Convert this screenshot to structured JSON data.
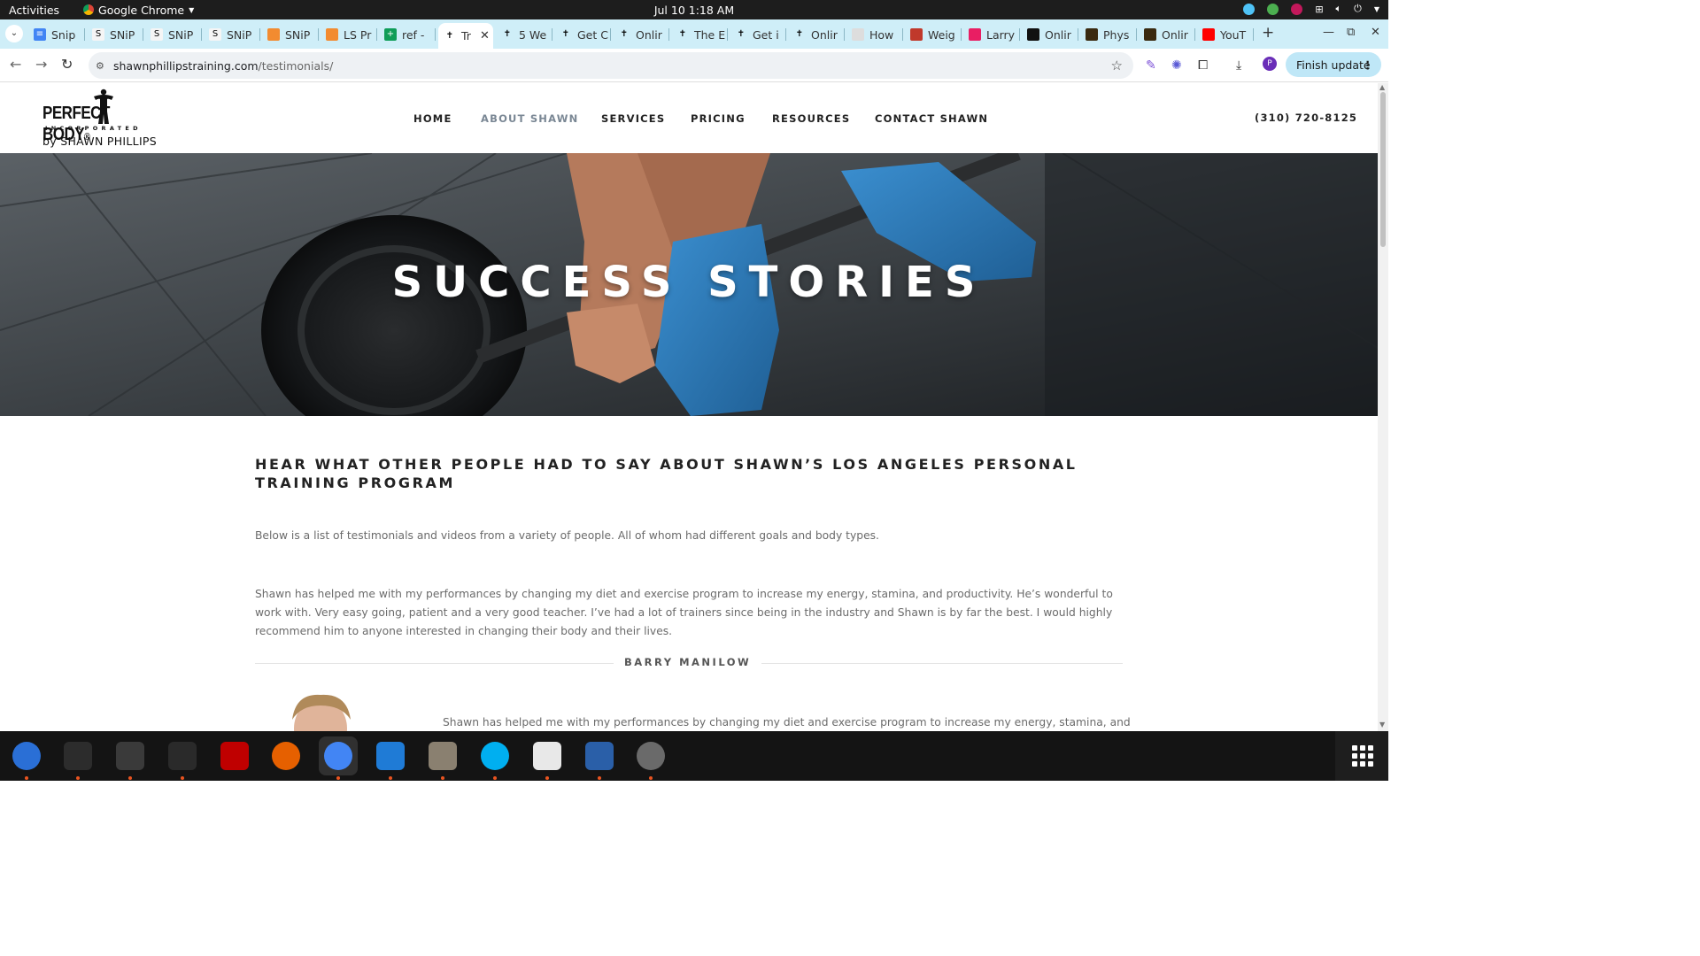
{
  "system_bar": {
    "activities": "Activities",
    "app_name": "Google Chrome",
    "clock": "Jul 10  1:18 AM"
  },
  "browser": {
    "tabs": [
      {
        "label": "Snip",
        "icon": "google-docs-icon"
      },
      {
        "label": "SNiP",
        "icon": "snip-icon"
      },
      {
        "label": "SNiP",
        "icon": "snip-icon"
      },
      {
        "label": "SNiP",
        "icon": "snip-icon"
      },
      {
        "label": "SNiP",
        "icon": "orange-chrome-icon"
      },
      {
        "label": "LS Pr",
        "icon": "orange-chrome-icon"
      },
      {
        "label": "ref - ",
        "icon": "google-sheets-icon"
      },
      {
        "label": "Tr",
        "icon": "perfect-body-icon",
        "active": true
      },
      {
        "label": "5 We",
        "icon": "perfect-body-icon"
      },
      {
        "label": "Get C",
        "icon": "perfect-body-icon"
      },
      {
        "label": "Onlir",
        "icon": "perfect-body-icon"
      },
      {
        "label": "The E",
        "icon": "perfect-body-icon"
      },
      {
        "label": "Get i",
        "icon": "perfect-body-icon"
      },
      {
        "label": "Onlir",
        "icon": "perfect-body-icon"
      },
      {
        "label": "How",
        "icon": "page-icon"
      },
      {
        "label": "Weig",
        "icon": "weight-icon"
      },
      {
        "label": "Larry",
        "icon": "larry-icon"
      },
      {
        "label": "Onlir",
        "icon": "black-square-icon"
      },
      {
        "label": "Phys",
        "icon": "phys-icon"
      },
      {
        "label": "Onlir",
        "icon": "phys-icon"
      },
      {
        "label": "YouT",
        "icon": "youtube-icon"
      }
    ],
    "url_host": "shawnphillipstraining.com",
    "url_path": "/testimonials/",
    "finish_update": "Finish update",
    "profile_initial": "P"
  },
  "site": {
    "logo": {
      "brand_left": "PERFECT",
      "brand_right": "BODY",
      "registered": "®",
      "incorporated": "INCORPORATED",
      "byline": "by SHAWN PHILLIPS"
    },
    "nav": {
      "home": "HOME",
      "about": "ABOUT SHAWN",
      "services": "SERVICES",
      "pricing": "PRICING",
      "resources": "RESOURCES",
      "contact": "CONTACT SHAWN"
    },
    "phone": "(310) 720-8125",
    "hero_title": "SUCCESS STORIES",
    "heading": "HEAR WHAT OTHER PEOPLE HAD TO SAY ABOUT SHAWN’S LOS ANGELES PERSONAL TRAINING PROGRAM",
    "intro": "Below is a list of testimonials and videos from a variety of people.  All of whom had different goals and body types.",
    "testimonial_1": {
      "text": "Shawn has helped me with my performances by changing my diet and exercise program to increase my energy, stamina, and productivity. He’s wonderful to work with. Very easy going, patient and a very good teacher. I’ve had a lot of trainers since being in the industry and Shawn is by far the best. I would highly recommend him to anyone interested in changing their body and their lives.",
      "author": "BARRY MANILOW"
    },
    "testimonial_2": {
      "text": "Shawn has helped me with my performances by changing my diet and exercise program to increase my energy, stamina, and"
    }
  },
  "dock": [
    {
      "name": "thunderbird",
      "color": "#2a6fd6"
    },
    {
      "name": "terminal",
      "color": "#2c2c2c"
    },
    {
      "name": "calculator",
      "color": "#3a3a3a"
    },
    {
      "name": "system-monitor",
      "color": "#2a2a2a"
    },
    {
      "name": "filezilla",
      "color": "#bf0000"
    },
    {
      "name": "firefox",
      "color": "#e66000"
    },
    {
      "name": "chrome",
      "color": "#4285f4"
    },
    {
      "name": "vscode",
      "color": "#1f7bd6"
    },
    {
      "name": "files",
      "color": "#8a8070"
    },
    {
      "name": "skype",
      "color": "#00aff0"
    },
    {
      "name": "text-editor",
      "color": "#e8e8e8"
    },
    {
      "name": "libreoffice-writer",
      "color": "#2a5fa8"
    },
    {
      "name": "disk-utility",
      "color": "#6a6a6a"
    }
  ]
}
